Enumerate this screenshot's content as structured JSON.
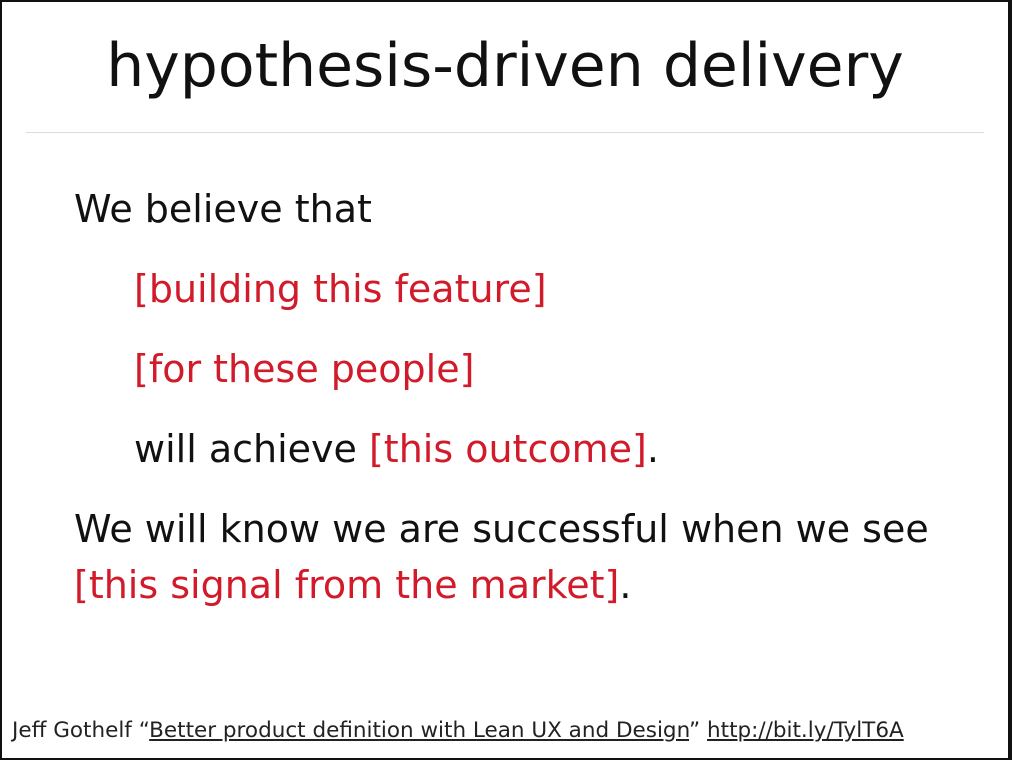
{
  "slide": {
    "title": "hypothesis-driven delivery",
    "lines": {
      "we_believe": "We believe that",
      "feature": "[building this feature]",
      "people": "[for these people]",
      "achieve_prefix": "will achieve ",
      "outcome": "[this outcome]",
      "period": ".",
      "know_success": "We will know we are successful when we see",
      "signal": "[this signal from the market]"
    },
    "footer": {
      "author": "Jeff Gothelf",
      "open_quote": " “",
      "article_link": "Better product definition with Lean UX and Design",
      "close_quote": "” ",
      "short_url": "http://bit.ly/TylT6A"
    }
  },
  "colors": {
    "accent_red": "#d11a2a",
    "text": "#111111",
    "background": "#ffffff"
  }
}
